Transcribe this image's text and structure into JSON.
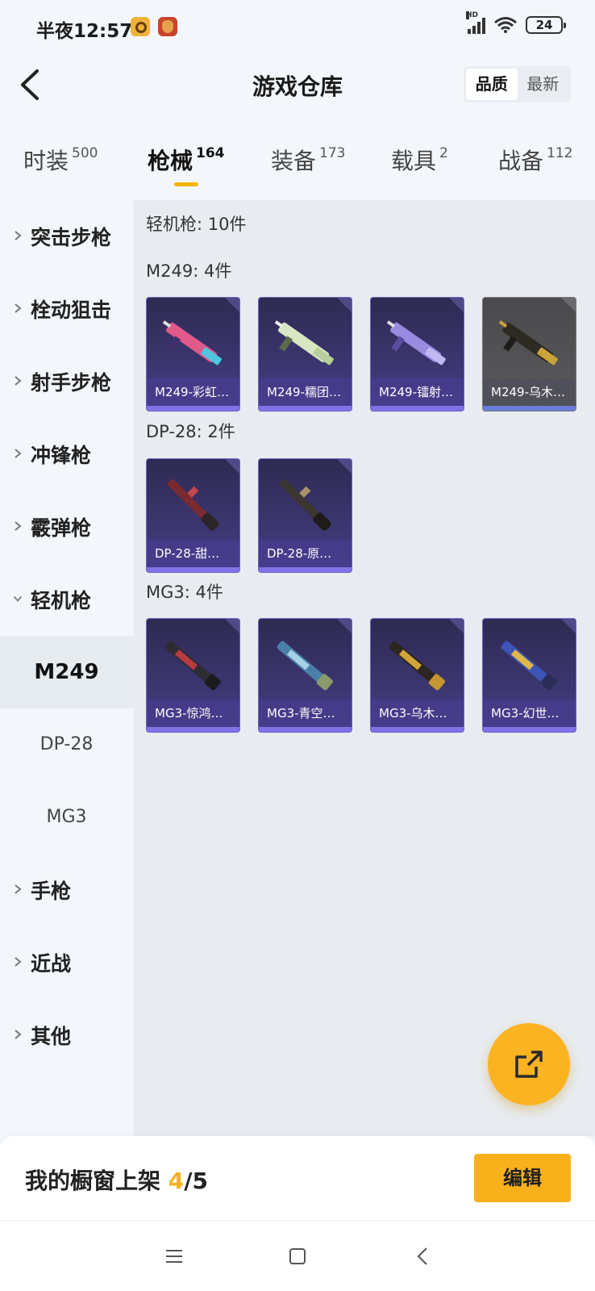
{
  "status_bar": {
    "time": "半夜12:57",
    "battery": "24",
    "network": "HD"
  },
  "header": {
    "title": "游戏仓库",
    "sort_options": [
      "品质",
      "最新"
    ],
    "sort_active": "品质"
  },
  "tabs": [
    {
      "label": "时装",
      "count": "500"
    },
    {
      "label": "枪械",
      "count": "164",
      "active": true
    },
    {
      "label": "装备",
      "count": "173"
    },
    {
      "label": "载具",
      "count": "2"
    },
    {
      "label": "战备",
      "count": "112"
    }
  ],
  "sidebar": {
    "categories": [
      "突击步枪",
      "栓动狙击",
      "射手步枪",
      "冲锋枪",
      "霰弹枪",
      "轻机枪",
      "手枪",
      "近战",
      "其他"
    ],
    "sub_items": [
      "M249",
      "DP-28",
      "MG3"
    ],
    "active_sub": "M249"
  },
  "content": {
    "summary": "轻机枪: 10件",
    "sections": [
      {
        "title": "M249: 4件",
        "items": [
          "M249-彩虹…",
          "M249-糯团…",
          "M249-镭射…",
          "M249-乌木…"
        ]
      },
      {
        "title": "DP-28: 2件",
        "items": [
          "DP-28-甜…",
          "DP-28-原…"
        ]
      },
      {
        "title": "MG3: 4件",
        "items": [
          "MG3-惊鸿…",
          "MG3-青空…",
          "MG3-乌木…",
          "MG3-幻世…"
        ]
      }
    ]
  },
  "showcase": {
    "label": "我的橱窗上架 ",
    "current": "4",
    "total": "/5",
    "edit_label": "编辑"
  },
  "colors": {
    "accent": "#f9b11b",
    "card_purple": "#3b3670",
    "card_border": "#6c63c8",
    "gray_card": "#5a5a5e"
  }
}
